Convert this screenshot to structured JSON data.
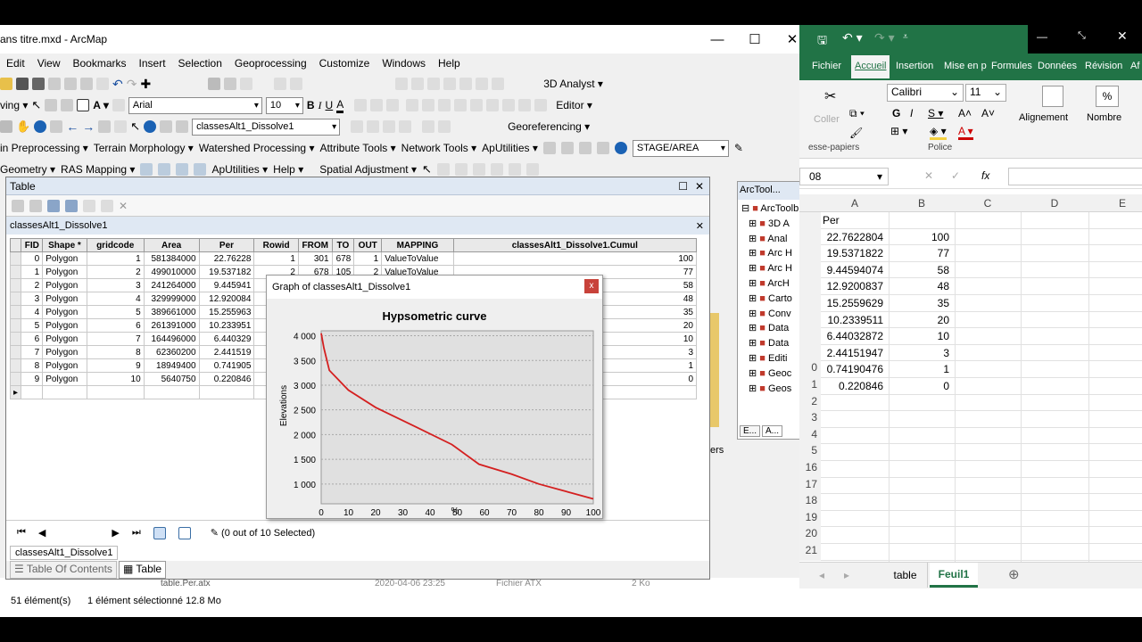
{
  "arcmap": {
    "title": "ans titre.mxd - ArcMap",
    "menus": [
      "Edit",
      "View",
      "Bookmarks",
      "Insert",
      "Selection",
      "Geoprocessing",
      "Customize",
      "Windows",
      "Help"
    ],
    "toolbar2": {
      "font": "Arial",
      "size": "10",
      "editor": "Editor",
      "analyst": "3D Analyst"
    },
    "toolbar3": {
      "layer": "classesAlt1_Dissolve1",
      "georef": "Georeferencing"
    },
    "toolbar4": [
      "in Preprocessing",
      "Terrain Morphology",
      "Watershed Processing",
      "Attribute Tools",
      "Network Tools",
      "ApUtilities"
    ],
    "toolbar4_field": "STAGE/AREA",
    "toolbar5": [
      "Geometry",
      "RAS Mapping",
      "ApUtilities",
      "Help",
      "Spatial Adjustment"
    ],
    "table_window": {
      "title": "Table",
      "tab_title": "classesAlt1_Dissolve1",
      "columns": [
        "FID",
        "Shape *",
        "gridcode",
        "Area",
        "Per",
        "Rowid",
        "FROM",
        "TO",
        "OUT",
        "MAPPING",
        "classesAlt1_Dissolve1.Cumul"
      ],
      "rows": [
        [
          "0",
          "Polygon",
          "1",
          "581384000",
          "22.76228",
          "1",
          "301",
          "678",
          "1",
          "ValueToValue",
          "100"
        ],
        [
          "1",
          "Polygon",
          "2",
          "499010000",
          "19.537182",
          "2",
          "678",
          "105",
          "2",
          "ValueToValue",
          "77"
        ],
        [
          "2",
          "Polygon",
          "3",
          "241264000",
          "9.445941",
          "",
          "",
          "",
          "",
          "",
          "58"
        ],
        [
          "3",
          "Polygon",
          "4",
          "329999000",
          "12.920084",
          "",
          "",
          "",
          "",
          "",
          "48"
        ],
        [
          "4",
          "Polygon",
          "5",
          "389661000",
          "15.255963",
          "",
          "",
          "",
          "",
          "",
          "35"
        ],
        [
          "5",
          "Polygon",
          "6",
          "261391000",
          "10.233951",
          "",
          "",
          "",
          "",
          "",
          "20"
        ],
        [
          "6",
          "Polygon",
          "7",
          "164496000",
          "6.440329",
          "",
          "",
          "",
          "",
          "",
          "10"
        ],
        [
          "7",
          "Polygon",
          "8",
          "62360200",
          "2.441519",
          "",
          "",
          "",
          "",
          "",
          "3"
        ],
        [
          "8",
          "Polygon",
          "9",
          "18949400",
          "0.741905",
          "",
          "",
          "",
          "",
          "",
          "1"
        ],
        [
          "9",
          "Polygon",
          "10",
          "5640750",
          "0.220846",
          "",
          "",
          "",
          "",
          "",
          "0"
        ]
      ],
      "selection": "(0 out of 10 Selected)",
      "bottom_tab": "classesAlt1_Dissolve1",
      "toc_tab": "Table Of Contents",
      "table_tab": "Table"
    },
    "graph_window": {
      "title": "Graph of classesAlt1_Dissolve1",
      "close": "x"
    },
    "arctoolbox": {
      "title": "ArcTool...",
      "root": "ArcToolb",
      "items": [
        "3D A",
        "Anal",
        "Arc H",
        "Arc H",
        "ArcH",
        "Carto",
        "Conv",
        "Data",
        "Data",
        "Editi",
        "Geoc",
        "Geos"
      ],
      "tabs": [
        "E...",
        "A..."
      ]
    },
    "behind_text": "ers",
    "explorer": {
      "file": "table.Per.atx",
      "date": "2020-04-06 23:25",
      "type": "Fichier ATX",
      "size": "2 Ko",
      "items": "51 élément(s)",
      "selected": "1 élément sélectionné  12.8 Mo"
    }
  },
  "chart_data": {
    "type": "line",
    "title": "Hypsometric curve",
    "xlabel": "%",
    "ylabel": "Elevations",
    "xlim": [
      0,
      100
    ],
    "ylim": [
      600,
      4100
    ],
    "xticks": [
      "0",
      "10",
      "20",
      "30",
      "40",
      "50",
      "60",
      "70",
      "80",
      "90",
      "100"
    ],
    "yticks": [
      "1 000",
      "1 500",
      "2 000",
      "2 500",
      "3 000",
      "3 500",
      "4 000"
    ],
    "ytick_values": [
      1000,
      1500,
      2000,
      2500,
      3000,
      3500,
      4000
    ],
    "grid": true,
    "color": "#d42020",
    "series": [
      {
        "x": [
          0,
          1,
          3,
          10,
          20,
          35,
          48,
          58,
          70,
          80,
          90,
          100
        ],
        "y": [
          4050,
          3750,
          3300,
          2900,
          2550,
          2150,
          1800,
          1400,
          1200,
          1000,
          850,
          700
        ]
      }
    ]
  },
  "excel": {
    "tabs": [
      "Fichier",
      "Accueil",
      "Insertion",
      "Mise en p",
      "Formules",
      "Données",
      "Révision",
      "Af"
    ],
    "font": "Calibri",
    "size": "11",
    "groups": {
      "clipboard": "esse-papiers",
      "font": "Police",
      "align": "Alignement",
      "number": "Nombre",
      "coller": "Coller"
    },
    "namebox": "08",
    "fx": "fx",
    "cols": [
      "A",
      "B",
      "C",
      "D",
      "E"
    ],
    "header_a": "Per",
    "colA": [
      "22.7622804",
      "19.5371822",
      "9.44594074",
      "12.9200837",
      "15.2559629",
      "10.2339511",
      "6.44032872",
      "2.44151947",
      "0.74190476",
      "0.220846"
    ],
    "colB": [
      "100",
      "77",
      "58",
      "48",
      "35",
      "20",
      "10",
      "3",
      "1",
      "0"
    ],
    "row_numbers": [
      "",
      "",
      "",
      "",
      "",
      "",
      "",
      "",
      "",
      "0",
      "1",
      "2",
      "3",
      "4",
      "5",
      "16",
      "17",
      "18",
      "19",
      "20",
      "21"
    ],
    "sheets": [
      "table",
      "Feuil1"
    ]
  }
}
